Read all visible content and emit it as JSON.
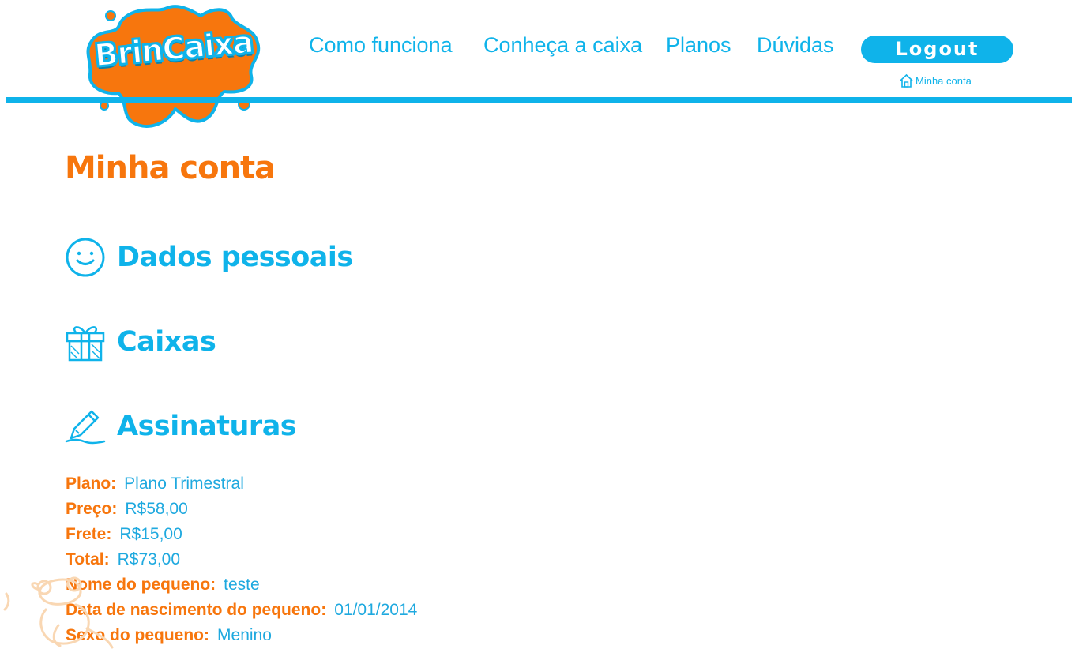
{
  "header": {
    "logo_text": "BrinCaixa",
    "nav": [
      {
        "label": "Como funciona"
      },
      {
        "label": "Conheça a caixa"
      },
      {
        "label": "Planos"
      },
      {
        "label": "Dúvidas"
      }
    ],
    "logout_label": "Logout",
    "account_label": "Minha conta",
    "account_icon": "home-icon"
  },
  "main": {
    "title": "Minha conta",
    "sections": [
      {
        "label": "Dados pessoais",
        "icon": "smiley-face-icon"
      },
      {
        "label": "Caixas",
        "icon": "gift-box-icon"
      },
      {
        "label": "Assinaturas",
        "icon": "pencil-signature-icon"
      }
    ],
    "subscription": [
      {
        "label": "Plano:",
        "value": "Plano Trimestral"
      },
      {
        "label": "Preço:",
        "value": "R$58,00"
      },
      {
        "label": "Frete:",
        "value": "R$15,00"
      },
      {
        "label": "Total:",
        "value": "R$73,00"
      },
      {
        "label": "Nome do pequeno:",
        "value": "teste"
      },
      {
        "label": "Data de nascimento do pequeno:",
        "value": "01/01/2014"
      },
      {
        "label": "Sexo do pequeno:",
        "value": "Menino"
      }
    ]
  },
  "colors": {
    "brand_blue": "#0fb3ea",
    "brand_orange": "#f7760d",
    "background": "#ffffff"
  }
}
